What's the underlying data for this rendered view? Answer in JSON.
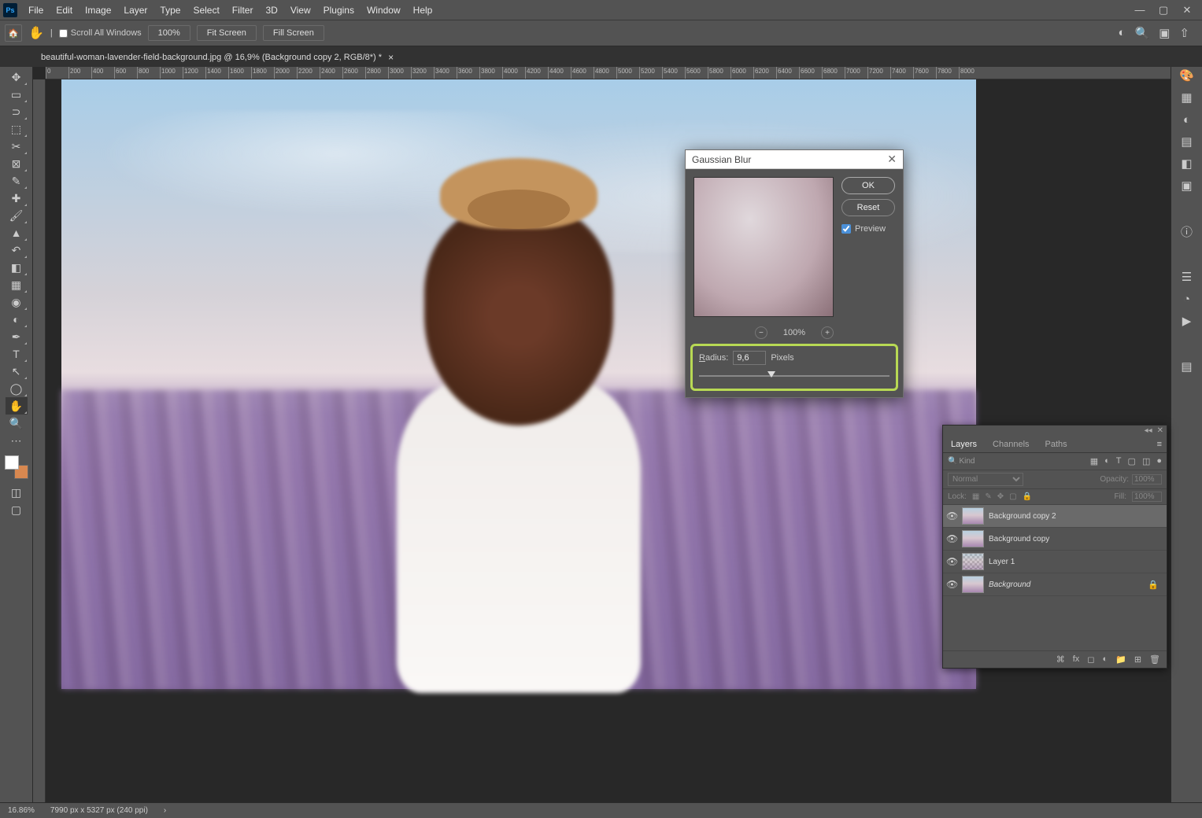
{
  "menu": [
    "File",
    "Edit",
    "Image",
    "Layer",
    "Type",
    "Select",
    "Filter",
    "3D",
    "View",
    "Plugins",
    "Window",
    "Help"
  ],
  "options": {
    "scroll_all": "Scroll All Windows",
    "zoom": "100%",
    "fit": "Fit Screen",
    "fill": "Fill Screen"
  },
  "tab": {
    "title": "beautiful-woman-lavender-field-background.jpg @ 16,9% (Background copy 2, RGB/8*) *"
  },
  "ruler_ticks": [
    "0",
    "200",
    "400",
    "600",
    "800",
    "1000",
    "1200",
    "1400",
    "1600",
    "1800",
    "2000",
    "2200",
    "2400",
    "2600",
    "2800",
    "3000",
    "3200",
    "3400",
    "3600",
    "3800",
    "4000",
    "4200",
    "4400",
    "4600",
    "4800",
    "5000",
    "5200",
    "5400",
    "5600",
    "5800",
    "6000",
    "6200",
    "6400",
    "6600",
    "6800",
    "7000",
    "7200",
    "7400",
    "7600",
    "7800",
    "8000"
  ],
  "dialog": {
    "title": "Gaussian Blur",
    "ok": "OK",
    "reset": "Reset",
    "preview": "Preview",
    "zoom": "100%",
    "radius_label": "Radius:",
    "radius_letter": "R",
    "radius_rest": "adius:",
    "radius_value": "9,6",
    "unit": "Pixels"
  },
  "layers_panel": {
    "tabs": [
      "Layers",
      "Channels",
      "Paths"
    ],
    "kind": "Kind",
    "blend": "Normal",
    "opacity_label": "Opacity:",
    "opacity": "100%",
    "lock_label": "Lock:",
    "fill_label": "Fill:",
    "fill": "100%",
    "layers": [
      {
        "name": "Background copy 2",
        "selected": true,
        "locked": false,
        "italic": false
      },
      {
        "name": "Background copy",
        "selected": false,
        "locked": false,
        "italic": false
      },
      {
        "name": "Layer 1",
        "selected": false,
        "locked": false,
        "italic": false,
        "masked": true
      },
      {
        "name": "Background",
        "selected": false,
        "locked": true,
        "italic": true
      }
    ]
  },
  "status": {
    "zoom": "16.86%",
    "doc": "7990 px x 5327 px (240 ppi)"
  }
}
